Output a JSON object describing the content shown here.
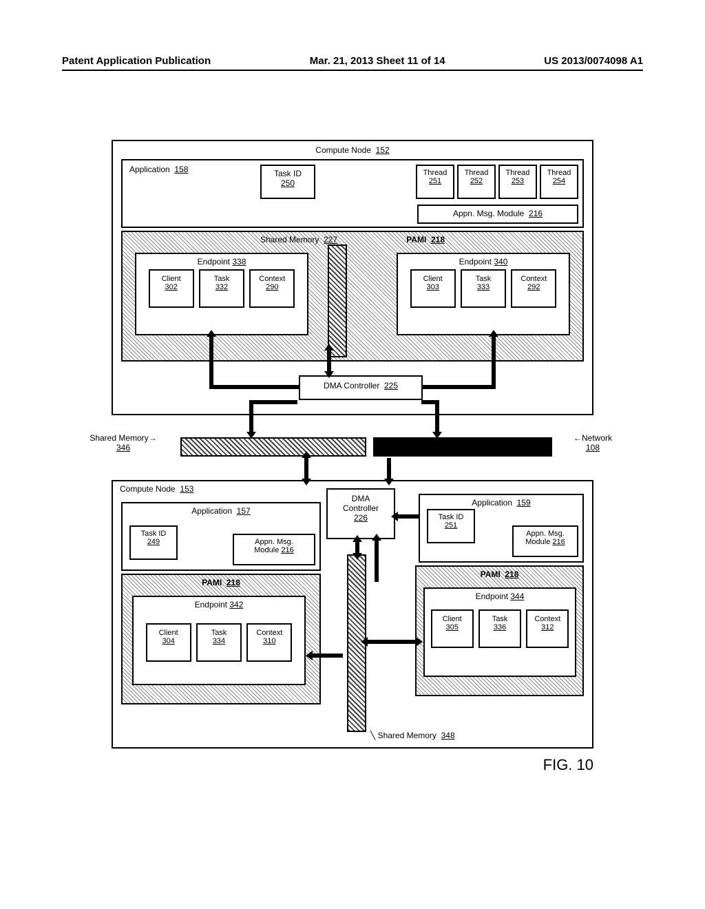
{
  "header": {
    "left": "Patent Application Publication",
    "center": "Mar. 21, 2013  Sheet 11 of 14",
    "right": "US 2013/0074098 A1"
  },
  "figure_label": "FIG. 10",
  "node152": {
    "title": "Compute Node",
    "title_ref": "152",
    "application": {
      "label": "Application",
      "ref": "158"
    },
    "task_id": {
      "label": "Task ID",
      "ref": "250"
    },
    "threads": [
      {
        "label": "Thread",
        "ref": "251"
      },
      {
        "label": "Thread",
        "ref": "252"
      },
      {
        "label": "Thread",
        "ref": "253"
      },
      {
        "label": "Thread",
        "ref": "254"
      }
    ],
    "app_msg": {
      "label": "Appn. Msg. Module",
      "ref": "216"
    },
    "pami": {
      "label": "PAMI",
      "ref": "218"
    },
    "shared_memory": {
      "label": "Shared Memory",
      "ref": "227"
    },
    "endpoint338": {
      "label": "Endpoint",
      "ref": "338",
      "client": {
        "label": "Client",
        "ref": "302"
      },
      "task": {
        "label": "Task",
        "ref": "332"
      },
      "context": {
        "label": "Context",
        "ref": "290"
      }
    },
    "endpoint340": {
      "label": "Endpoint",
      "ref": "340",
      "client": {
        "label": "Client",
        "ref": "303"
      },
      "task": {
        "label": "Task",
        "ref": "333"
      },
      "context": {
        "label": "Context",
        "ref": "292"
      }
    },
    "dma": {
      "label": "DMA Controller",
      "ref": "225"
    }
  },
  "bus": {
    "shared_memory": {
      "label": "Shared Memory",
      "ref": "346"
    },
    "network": {
      "label": "Network",
      "ref": "108"
    }
  },
  "node153": {
    "title": "Compute Node",
    "title_ref": "153",
    "dma": {
      "label": "DMA Controller",
      "ref": "226"
    },
    "shared_memory_348": {
      "label": "Shared Memory",
      "ref": "348"
    },
    "app157": {
      "label": "Application",
      "ref": "157",
      "task_id": {
        "label": "Task ID",
        "ref": "249"
      },
      "app_msg": {
        "label": "Appn. Msg. Module",
        "ref": "216"
      },
      "pami": {
        "label": "PAMI",
        "ref": "218"
      },
      "endpoint": {
        "label": "Endpoint",
        "ref": "342",
        "client": {
          "label": "Client",
          "ref": "304"
        },
        "task": {
          "label": "Task",
          "ref": "334"
        },
        "context": {
          "label": "Context",
          "ref": "310"
        }
      }
    },
    "app159": {
      "label": "Application",
      "ref": "159",
      "task_id": {
        "label": "Task ID",
        "ref": "251"
      },
      "app_msg": {
        "label": "Appn. Msg. Module",
        "ref": "216"
      },
      "pami": {
        "label": "PAMI",
        "ref": "218"
      },
      "endpoint": {
        "label": "Endpoint",
        "ref": "344",
        "client": {
          "label": "Client",
          "ref": "305"
        },
        "task": {
          "label": "Task",
          "ref": "336"
        },
        "context": {
          "label": "Context",
          "ref": "312"
        }
      }
    }
  }
}
